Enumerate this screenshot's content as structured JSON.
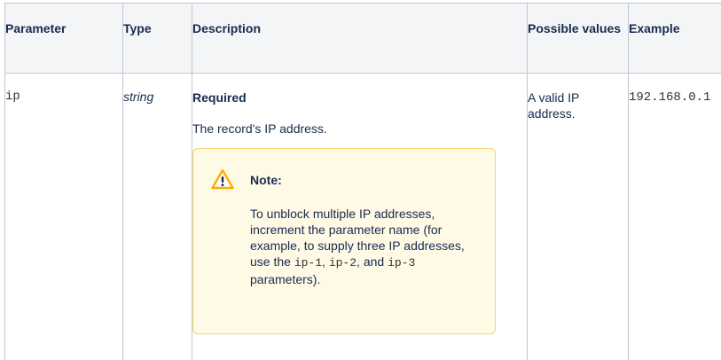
{
  "table": {
    "headers": {
      "parameter": "Parameter",
      "type": "Type",
      "description": "Description",
      "possible_values": "Possible values",
      "example": "Example"
    },
    "row": {
      "parameter": "ip",
      "type": "string",
      "required": "Required",
      "record_desc": "The record's IP address.",
      "possible_values": "A valid IP address.",
      "example": "192.168.0.1"
    }
  },
  "note": {
    "icon": "warning-icon",
    "title": "Note:",
    "body_prefix": "To unblock multiple IP addresses, increment the parameter name (for example, to supply three IP addresses, use the ",
    "code1": "ip-1",
    "sep1": ", ",
    "code2": "ip-2",
    "sep2": ", and ",
    "code3": "ip-3",
    "body_suffix": " parameters)."
  },
  "colors": {
    "note_bg": "#fffae6",
    "note_border": "#f5d76e",
    "warning_icon": "#ffab00",
    "table_border": "#c1c7d0",
    "header_bg": "#f4f5f7"
  }
}
